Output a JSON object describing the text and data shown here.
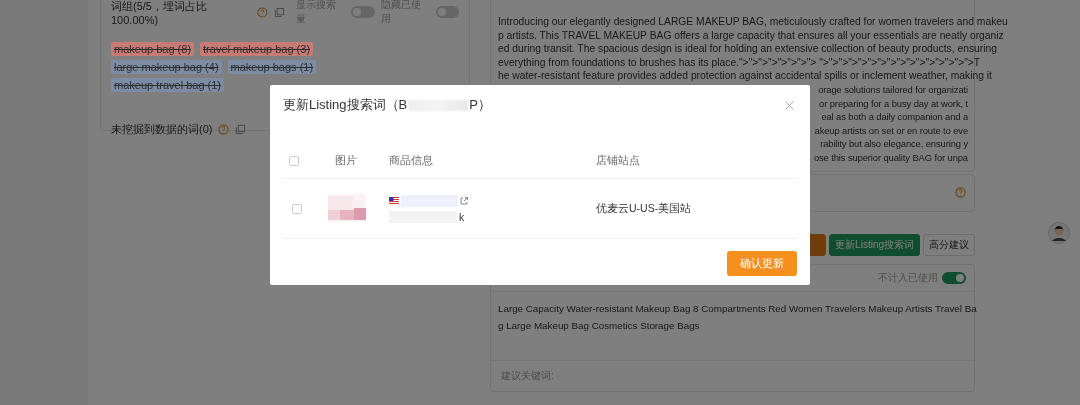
{
  "keyword_panel": {
    "title": "词组(5/5，埋词占比100.00%)",
    "toggles": [
      {
        "label": "显示搜索量",
        "on": false
      },
      {
        "label": "隐藏已使用",
        "on": false
      }
    ],
    "tags": [
      {
        "label": "makeup bag (8)",
        "color": "#c87a74",
        "used": true
      },
      {
        "label": "travel makeup bag (3)",
        "color": "#c87a74",
        "used": true
      },
      {
        "label": "large makeup bag (4)",
        "color": "#7d8ca5",
        "used": true
      },
      {
        "label": "makeup bags (1)",
        "color": "#7d8ca5",
        "used": true
      },
      {
        "label": "makeup travel bag (1)",
        "color": "#7d8ca5",
        "used": true
      }
    ],
    "unmined_label": "未挖掘到数据的词(0)"
  },
  "description": {
    "lines": [
      "Introducing our elegantly designed LARGE MAKEUP BAG, meticulously crafted for women travelers and makeu",
      "p artists. This TRAVEL MAKEUP BAG offers a large capacity that ensures all your essentials are neatly organiz",
      "ed during transit. The spacious design is ideal for holding an extensive collection of beauty products, ensuring",
      "everything from foundations to brushes has its place.\">\">\">\">\">\">\">\"> \">\">\">\">\">\">\">\">\">\">\">\">\">\">\">\">T",
      "he water-resistant feature provides added protection against accidental spills or inclement weather, making it"
    ],
    "partial_lines": [
      "orage solutions tailored for organizati",
      "or preparing for a busy day at work, t",
      "eal as both a daily companion and a",
      "akeup artists on set or en route to eve",
      "rability but also elegance, ensuring y",
      "ose this superior quality BAG for unpa"
    ]
  },
  "actions": [
    {
      "kind": "orange"
    },
    {
      "kind": "green",
      "label": "更新Listing搜索词"
    },
    {
      "kind": "plain",
      "label": "高分建议"
    }
  ],
  "title_card": {
    "toggle": {
      "label": "不计入已使用",
      "on": true
    },
    "lines": [
      "Large Capacity Water-resistant Makeup Bag 8 Compartments Red Women Travelers Makeup Artists Travel Ba",
      "g Large Makeup Bag Cosmetics Storage Bags"
    ],
    "footer_label": "建议关键词:"
  },
  "modal": {
    "title_start": "更新Listing搜索词（B",
    "title_end": "P）",
    "header_checked": false,
    "columns": [
      "图片",
      "商品信息",
      "店铺站点"
    ],
    "rows": [
      {
        "checked": false,
        "code_end": "k",
        "store": "优麦云U-US-美国站"
      }
    ],
    "confirm": "确认更新"
  }
}
